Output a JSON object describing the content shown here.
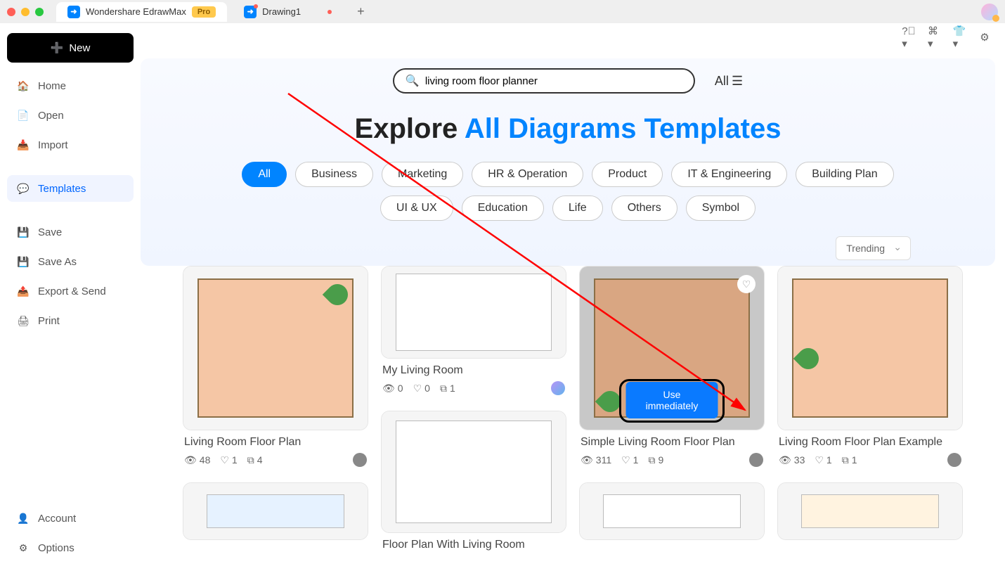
{
  "titlebar": {
    "app_name": "Wondershare EdrawMax",
    "badge": "Pro",
    "secondary_tab": "Drawing1"
  },
  "sidebar": {
    "new_label": "New",
    "items": [
      {
        "icon": "home-icon",
        "label": "Home"
      },
      {
        "icon": "open-icon",
        "label": "Open"
      },
      {
        "icon": "import-icon",
        "label": "Import"
      },
      {
        "icon": "templates-icon",
        "label": "Templates",
        "active": true
      },
      {
        "icon": "save-icon",
        "label": "Save"
      },
      {
        "icon": "saveas-icon",
        "label": "Save As"
      },
      {
        "icon": "export-icon",
        "label": "Export & Send"
      },
      {
        "icon": "print-icon",
        "label": "Print"
      }
    ],
    "bottom": [
      {
        "icon": "account-icon",
        "label": "Account"
      },
      {
        "icon": "options-icon",
        "label": "Options"
      }
    ]
  },
  "search": {
    "value": "living room floor planner",
    "all_label": "All"
  },
  "explore": {
    "prefix": "Explore ",
    "highlight": "All Diagrams Templates"
  },
  "categories": [
    "All",
    "Business",
    "Marketing",
    "HR & Operation",
    "Product",
    "IT & Engineering",
    "Building Plan",
    "UI & UX",
    "Education",
    "Life",
    "Others",
    "Symbol"
  ],
  "sort": {
    "label": "Trending"
  },
  "templates": {
    "t1": {
      "title": "Living Room Floor Plan",
      "views": "48",
      "likes": "1",
      "copies": "4"
    },
    "t2": {
      "title": "My Living Room",
      "views": "0",
      "likes": "0",
      "copies": "1"
    },
    "t3": {
      "title": "Simple Living Room Floor Plan",
      "views": "311",
      "likes": "1",
      "copies": "9",
      "use_label": "Use immediately"
    },
    "t4": {
      "title": "Living Room Floor Plan Example",
      "views": "33",
      "likes": "1",
      "copies": "1"
    },
    "t5": {
      "title": "Floor Plan With Living Room"
    }
  }
}
